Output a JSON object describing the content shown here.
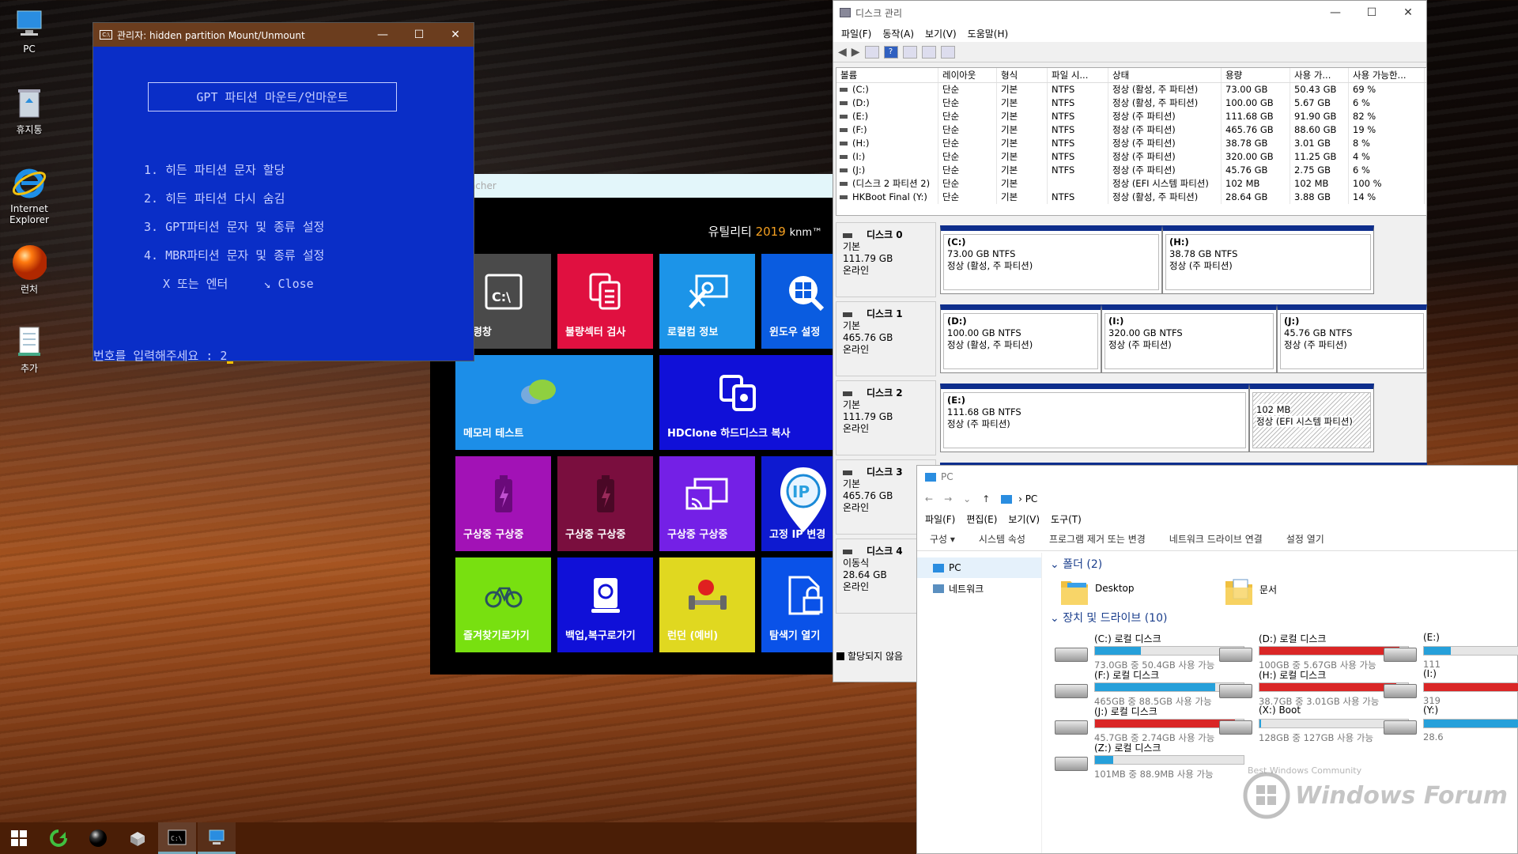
{
  "desktop": {
    "icons": [
      {
        "label": "PC"
      },
      {
        "label": "휴지통"
      },
      {
        "label": "Internet Explorer"
      },
      {
        "label": "런처"
      },
      {
        "label": "추가"
      }
    ]
  },
  "console": {
    "title": "관리자:  hidden partition Mount/Unmount",
    "header": "GPT 파티션 마운트/언마운트",
    "items": [
      "1. 히든 파티션 문자 할당",
      "2. 히든 파티션 다시 숨김",
      "3. GPT파티션 문자 및 종류 설정",
      "4. MBR파티션 문자 및 종류 설정",
      "X 또는 엔터     ↘ Close"
    ],
    "prompt": "번호를 입력해주세요 : 2"
  },
  "launcher": {
    "title": "Launcher",
    "brand": "유틸리티",
    "year": "2019",
    "author": "knm™",
    "tiles": [
      {
        "label": "명령창",
        "color": "#4a4a4a"
      },
      {
        "label": "불량섹터 검사",
        "color": "#e01040"
      },
      {
        "label": "로컬컴 정보",
        "color": "#1c94e8"
      },
      {
        "label": "윈도우 설정",
        "color": "#0a5ce0"
      },
      {
        "label": "메모리 테스트",
        "color": "#1c8ee8"
      },
      {
        "label": "HDClone 하드디스크 복사",
        "color": "#1010d8"
      },
      {
        "label": "구상중 구상중",
        "color": "#a212b6"
      },
      {
        "label": "구상중 구상중",
        "color": "#7a0e3e"
      },
      {
        "label": "구상중 구상중",
        "color": "#7420e6"
      },
      {
        "label": "고정 IP 변경",
        "color": "#0e1ad0"
      },
      {
        "label": "즐겨찾기로가기",
        "color": "#78e010"
      },
      {
        "label": "백업,복구로가기",
        "color": "#1010d8"
      },
      {
        "label": "런던 (예비)",
        "color": "#e0d820"
      },
      {
        "label": "탐색기 열기",
        "color": "#0a52e8"
      }
    ]
  },
  "diskmgmt": {
    "title": "디스크 관리",
    "menu": [
      "파일(F)",
      "동작(A)",
      "보기(V)",
      "도움말(H)"
    ],
    "columns": [
      "볼륨",
      "레이아웃",
      "형식",
      "파일 시...",
      "상태",
      "용량",
      "사용 가...",
      "사용 가능한..."
    ],
    "volumes": [
      [
        "(C:)",
        "단순",
        "기본",
        "NTFS",
        "정상 (활성, 주 파티션)",
        "73.00 GB",
        "50.43 GB",
        "69 %"
      ],
      [
        "(D:)",
        "단순",
        "기본",
        "NTFS",
        "정상 (활성, 주 파티션)",
        "100.00 GB",
        "5.67 GB",
        "6 %"
      ],
      [
        "(E:)",
        "단순",
        "기본",
        "NTFS",
        "정상 (주 파티션)",
        "111.68 GB",
        "91.90 GB",
        "82 %"
      ],
      [
        "(F:)",
        "단순",
        "기본",
        "NTFS",
        "정상 (주 파티션)",
        "465.76 GB",
        "88.60 GB",
        "19 %"
      ],
      [
        "(H:)",
        "단순",
        "기본",
        "NTFS",
        "정상 (주 파티션)",
        "38.78 GB",
        "3.01 GB",
        "8 %"
      ],
      [
        "(I:)",
        "단순",
        "기본",
        "NTFS",
        "정상 (주 파티션)",
        "320.00 GB",
        "11.25 GB",
        "4 %"
      ],
      [
        "(J:)",
        "단순",
        "기본",
        "NTFS",
        "정상 (주 파티션)",
        "45.76 GB",
        "2.75 GB",
        "6 %"
      ],
      [
        "(디스크 2 파티션 2)",
        "단순",
        "기본",
        "",
        "정상 (EFI 시스템 파티션)",
        "102 MB",
        "102 MB",
        "100 %"
      ],
      [
        "HKBoot Final (Y:)",
        "단순",
        "기본",
        "NTFS",
        "정상 (활성, 주 파티션)",
        "28.64 GB",
        "3.88 GB",
        "14 %"
      ]
    ],
    "disks": [
      {
        "name": "디스크 0",
        "type": "기본",
        "size": "111.79 GB",
        "status": "온라인",
        "parts": [
          {
            "l1": "(C:)",
            "l2": "73.00 GB NTFS",
            "l3": "정상 (활성, 주 파티션)"
          },
          {
            "l1": "(H:)",
            "l2": "38.78 GB NTFS",
            "l3": "정상 (주 파티션)"
          }
        ]
      },
      {
        "name": "디스크 1",
        "type": "기본",
        "size": "465.76 GB",
        "status": "온라인",
        "parts": [
          {
            "l1": "(D:)",
            "l2": "100.00 GB NTFS",
            "l3": "정상 (활성, 주 파티션)"
          },
          {
            "l1": "(I:)",
            "l2": "320.00 GB NTFS",
            "l3": "정상 (주 파티션)"
          },
          {
            "l1": "(J:)",
            "l2": "45.76 GB NTFS",
            "l3": "정상 (주 파티션)"
          }
        ]
      },
      {
        "name": "디스크 2",
        "type": "기본",
        "size": "111.79 GB",
        "status": "온라인",
        "parts": [
          {
            "l1": "(E:)",
            "l2": "111.68 GB NTFS",
            "l3": "정상 (주 파티션)"
          },
          {
            "l1": "",
            "l2": "102 MB",
            "l3": "정상 (EFI 시스템 파티션)"
          }
        ]
      },
      {
        "name": "디스크 3",
        "type": "기본",
        "size": "465.76 GB",
        "status": "온라인"
      },
      {
        "name": "디스크 4",
        "type": "이동식",
        "size": "28.64 GB",
        "status": "온라인"
      }
    ],
    "legend": "할당되지 않음"
  },
  "explorer": {
    "title": "PC",
    "address": "PC",
    "menu": [
      "파일(F)",
      "편집(E)",
      "보기(V)",
      "도구(T)"
    ],
    "ribbon": [
      "구성 ▾",
      "시스템 속성",
      "프로그램 제거 또는 변경",
      "네트워크 드라이브 연결",
      "설정 열기"
    ],
    "sidebar": [
      "PC",
      "네트워크"
    ],
    "folders_header": "폴더 (2)",
    "folders": [
      "Desktop",
      "문서"
    ],
    "drives_header": "장치 및 드라이브 (10)",
    "drives": [
      {
        "name": "(C:) 로컬 디스크",
        "space": "73.0GB 중 50.4GB 사용 가능",
        "used": 0.31,
        "color": "#26a0da"
      },
      {
        "name": "(D:) 로컬 디스크",
        "space": "100GB 중 5.67GB 사용 가능",
        "used": 0.94,
        "color": "#da2626"
      },
      {
        "name": "(E:)",
        "space": "111",
        "used": 0.18,
        "color": "#26a0da"
      },
      {
        "name": "(F:) 로컬 디스크",
        "space": "465GB 중 88.5GB 사용 가능",
        "used": 0.81,
        "color": "#26a0da"
      },
      {
        "name": "(H:) 로컬 디스크",
        "space": "38.7GB 중 3.01GB 사용 가능",
        "used": 0.92,
        "color": "#da2626"
      },
      {
        "name": "(I:)",
        "space": "319",
        "used": 0.96,
        "color": "#da2626"
      },
      {
        "name": "(J:) 로컬 디스크",
        "space": "45.7GB 중 2.74GB 사용 가능",
        "used": 0.94,
        "color": "#da2626"
      },
      {
        "name": "(X:) Boot",
        "space": "128GB 중 127GB 사용 가능",
        "used": 0.01,
        "color": "#26a0da"
      },
      {
        "name": "(Y:)",
        "space": "28.6",
        "used": 0.86,
        "color": "#26a0da"
      },
      {
        "name": "(Z:) 로컬 디스크",
        "space": "101MB 중 88.9MB 사용 가능",
        "used": 0.12,
        "color": "#26a0da"
      }
    ]
  },
  "watermark": {
    "line1": "Best Windows Community",
    "line2": "Windows Forum"
  }
}
